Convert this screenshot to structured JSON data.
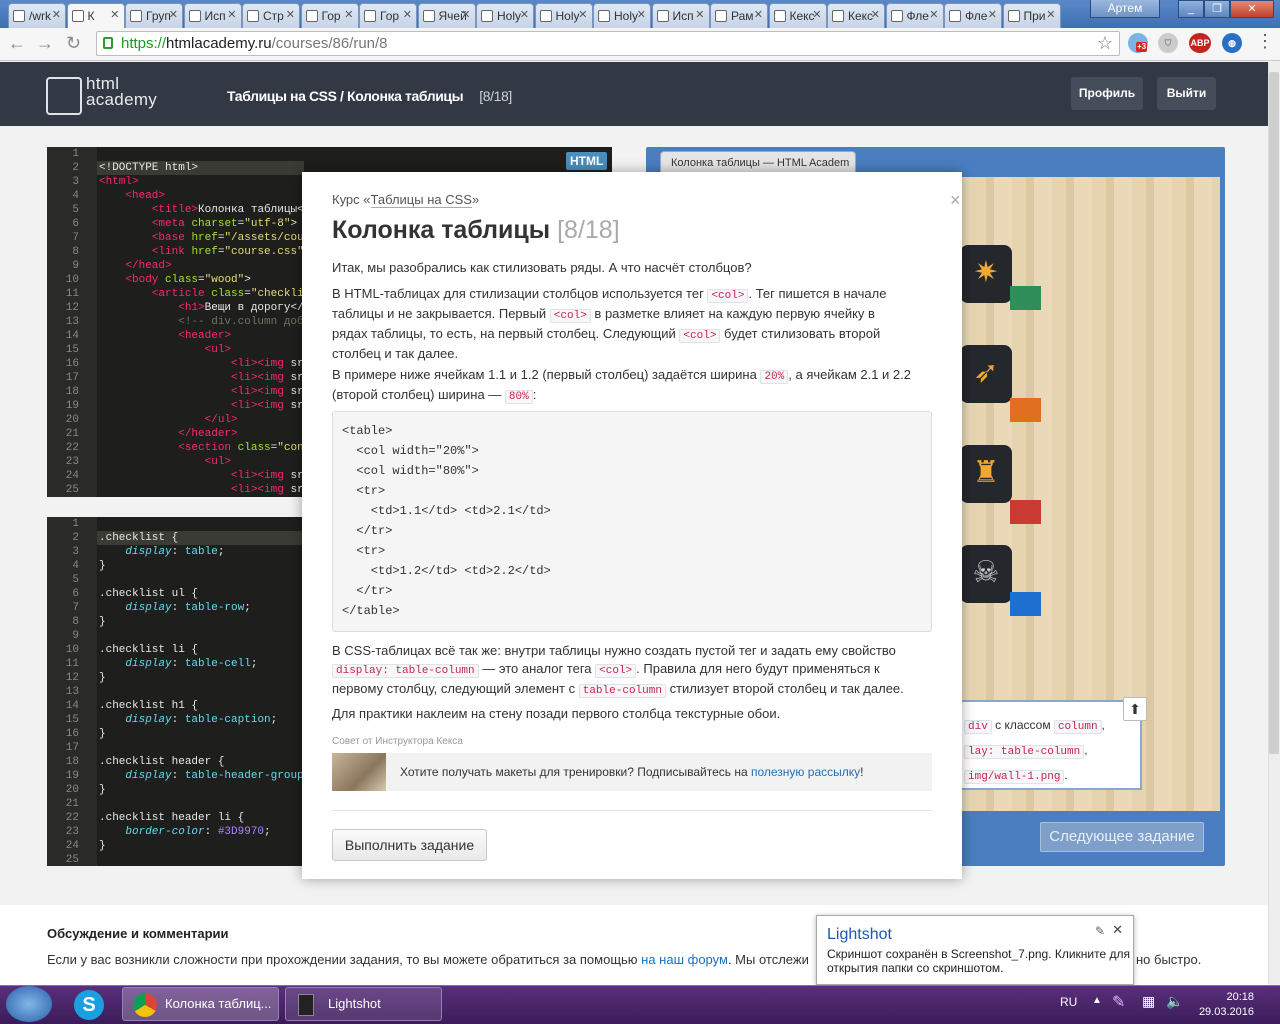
{
  "browser": {
    "tabs": [
      {
        "label": "/wrk"
      },
      {
        "label": "К",
        "active": true
      },
      {
        "label": "Груп"
      },
      {
        "label": "Исп"
      },
      {
        "label": "Стр"
      },
      {
        "label": "Гор"
      },
      {
        "label": "Гор"
      },
      {
        "label": "Ячей"
      },
      {
        "label": "Holy"
      },
      {
        "label": "Holy"
      },
      {
        "label": "Holy"
      },
      {
        "label": "Исп"
      },
      {
        "label": "Рам"
      },
      {
        "label": "Кекс"
      },
      {
        "label": "Кекс"
      },
      {
        "label": "Фле"
      },
      {
        "label": "Фле"
      },
      {
        "label": "При"
      }
    ],
    "user_button": "Артем",
    "url_scheme": "https://",
    "url_host": "htmlacademy.ru",
    "url_path": "/courses/86/run/8",
    "ext_badge": "+3",
    "ext_abp": "ABP"
  },
  "site": {
    "logo_line1": "html",
    "logo_line2": "academy",
    "crumb_course": "Таблицы на CSS",
    "crumb_sep": " / ",
    "crumb_lesson": "Колонка таблицы",
    "crumb_count": "[8/18]",
    "profile_btn": "Профиль",
    "logout_btn": "Выйти"
  },
  "html_editor": {
    "badge": "HTML",
    "lines": [
      "1",
      "2",
      "3",
      "4",
      "5",
      "6",
      "7",
      "8",
      "9",
      "10",
      "11",
      "12",
      "13",
      "14",
      "15",
      "16",
      "17",
      "18",
      "19",
      "20",
      "21",
      "22",
      "23",
      "24",
      "25"
    ]
  },
  "css_editor": {
    "lines": [
      "1",
      "2",
      "3",
      "4",
      "5",
      "6",
      "7",
      "8",
      "9",
      "10",
      "11",
      "12",
      "13",
      "14",
      "15",
      "16",
      "17",
      "18",
      "19",
      "20",
      "21",
      "22",
      "23",
      "24",
      "25"
    ]
  },
  "preview": {
    "tab_title": "Колонка таблицы — HTML Academ",
    "next_btn": "Следующее задание",
    "hint_l1_a": "div",
    "hint_l1_b": " с классом ",
    "hint_l1_c": "column",
    "hint_l1_d": ",",
    "hint_l2": "lay: table-column",
    "hint_l2_b": ",",
    "hint_l3": "img/wall-1.png",
    "hint_l3_b": "."
  },
  "modal": {
    "course_prefix": "Курс «",
    "course_name": "Таблицы на CSS",
    "course_suffix": "»",
    "close": "×",
    "title": "Колонка таблицы",
    "title_count": "[8/18]",
    "p1": "Итак, мы разобрались как стилизовать ряды. А что насчёт столбцов?",
    "p2_a": "В HTML-таблицах для стилизации столбцов используется тег ",
    "p2_code1": "<col>",
    "p2_b": ". Тег пишется в начале таблицы и не закрывается. Первый ",
    "p2_code2": "<col>",
    "p2_c": " в разметке влияет на каждую первую ячейку в рядах таблицы, то есть, на первый столбец. Следующий ",
    "p2_code3": "<col>",
    "p2_d": " будет стилизовать второй столбец и так далее.",
    "p3_a": "В примере ниже ячейкам 1.1 и 1.2 (первый столбец) задаётся ширина ",
    "p3_code1": "20%",
    "p3_b": ", а ячейкам 2.1 и 2.2 (второй столбец) ширина — ",
    "p3_code2": "80%",
    "p3_c": ":",
    "example_code": "<table>\n  <col width=\"20%\">\n  <col width=\"80%\">\n  <tr>\n    <td>1.1</td> <td>2.1</td>\n  </tr>\n  <tr>\n    <td>1.2</td> <td>2.2</td>\n  </tr>\n</table>",
    "p4_a": "В CSS-таблицах всё так же: внутри таблицы нужно создать пустой тег и задать ему свойство ",
    "p4_code1": "display: table-column",
    "p4_b": " — это аналог тега ",
    "p4_code2": "<col>",
    "p4_c": ". Правила для него будут применяться к первому столбцу, следующий элемент с ",
    "p4_code3": "table-column",
    "p4_d": " стилизует второй столбец и так далее.",
    "p5": "Для практики наклеим на стену позади первого столбца текстурные обои.",
    "tip_label": "Совет от Инструктора Кекса",
    "tip_text": "Хотите получать макеты для тренировки? Подписывайтесь на ",
    "tip_link": "полезную рассылку",
    "tip_end": "!",
    "run_btn": "Выполнить задание"
  },
  "discussion": {
    "title": "Обсуждение и комментарии",
    "text_a": "Если у вас возникли сложности при прохождении задания, то вы можете обратиться за помощью ",
    "link": "на наш форум",
    "text_b": ". Мы отслежи",
    "text_c": "но быстро."
  },
  "lightshot": {
    "title": "Lightshot",
    "message": "Скриншот сохранён в Screenshot_7.png. Кликните для открытия папки со скриншотом."
  },
  "taskbar": {
    "app1": "Колонка таблиц...",
    "app2": "Lightshot",
    "lang": "RU",
    "time": "20:18",
    "date": "29.03.2016"
  }
}
